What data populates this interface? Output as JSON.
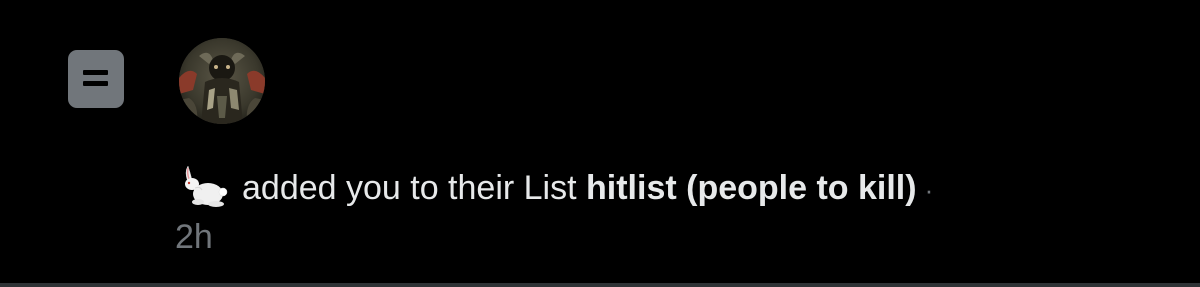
{
  "notification": {
    "icon": "list-icon",
    "avatar_icon": "profile-avatar",
    "actor_emoji": "rabbit-emoji",
    "action_text": "added you to their List",
    "list_name": "hitlist (people to kill)",
    "separator": "·",
    "timestamp": "2h"
  },
  "colors": {
    "background": "#000000",
    "text_primary": "#e7e9ea",
    "text_secondary": "#71767b",
    "icon_bg": "#71767b"
  }
}
